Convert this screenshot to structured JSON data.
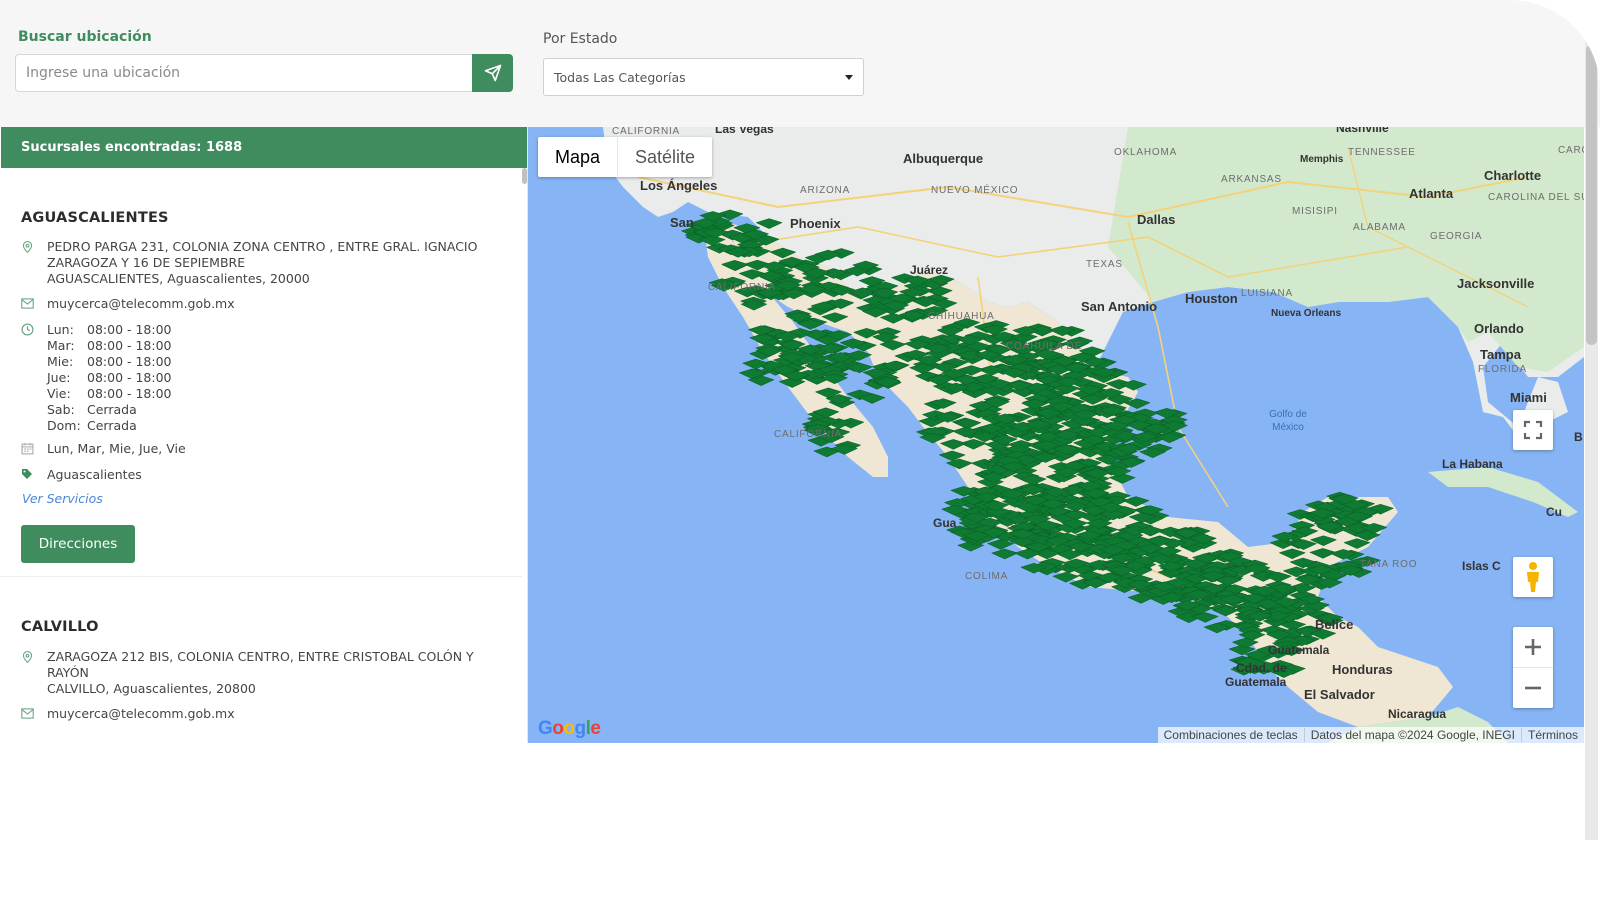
{
  "search": {
    "label": "Buscar ubicación",
    "placeholder": "Ingrese una ubicación",
    "value": ""
  },
  "state_filter": {
    "label": "Por Estado",
    "selected": "Todas Las Categorías"
  },
  "results": {
    "header": "Sucursales encontradas: 1688"
  },
  "branches": [
    {
      "name": "AGUASCALIENTES",
      "address_line1": "PEDRO PARGA 231, COLONIA ZONA CENTRO , ENTRE GRAL. IGNACIO",
      "address_line2": "ZARAGOZA Y 16 DE SEPIEMBRE",
      "address_line3": "AGUASCALIENTES, Aguascalientes, 20000",
      "email": "muycerca@telecomm.gob.mx",
      "hours": [
        {
          "day": "Lun:",
          "time": "08:00 - 18:00"
        },
        {
          "day": "Mar:",
          "time": "08:00 - 18:00"
        },
        {
          "day": "Mie:",
          "time": "08:00 - 18:00"
        },
        {
          "day": "Jue:",
          "time": "08:00 - 18:00"
        },
        {
          "day": "Vie:",
          "time": "08:00 - 18:00"
        },
        {
          "day": "Sab:",
          "time": "Cerrada"
        },
        {
          "day": "Dom:",
          "time": "Cerrada"
        }
      ],
      "open_days": "Lun, Mar, Mie, Jue, Vie",
      "category": "Aguascalientes",
      "services_link": "Ver Servicios",
      "directions_label": "Direcciones"
    },
    {
      "name": "CALVILLO",
      "address_line1": "ZARAGOZA 212 BIS, COLONIA CENTRO, ENTRE CRISTOBAL COLÓN Y",
      "address_line2": "RAYÓN",
      "address_line3": "CALVILLO, Aguascalientes, 20800",
      "email": "muycerca@telecomm.gob.mx"
    }
  ],
  "map": {
    "type_map": "Mapa",
    "type_satellite": "Satélite",
    "attribution_shortcuts": "Combinaciones de teclas",
    "attribution_data": "Datos del mapa ©2024 Google, INEGI",
    "attribution_terms": "Términos",
    "logo": "Google",
    "labels": {
      "las_vegas": "Las Vegas",
      "california": "CALIFORNIA",
      "nashville": "Nashville",
      "oklahoma": "OKLAHOMA",
      "tennessee": "TENNESSEE",
      "memphis": "Memphis",
      "carolina_del_norte": "CAROL",
      "albuquerque": "Albuquerque",
      "los_angeles": "Los Ángeles",
      "arizona": "ARIZONA",
      "nuevo_mexico": "NUEVO MÉXICO",
      "arkansas": "ARKANSAS",
      "charlotte": "Charlotte",
      "atlanta": "Atlanta",
      "carolina_del_sur": "CAROLINA DEL SUR",
      "san_diego": "San",
      "phoenix": "Phoenix",
      "misisipi": "MISISIPI",
      "alabama": "ALABAMA",
      "georgia": "GEORGIA",
      "dallas": "Dallas",
      "baja_california": "CALIFORNIA",
      "texas": "TEXAS",
      "juarez": "Juárez",
      "jacksonville": "Jacksonville",
      "luisiana": "LUISIANA",
      "houston": "Houston",
      "san_antonio": "San Antonio",
      "nueva_orleans": "Nueva Orleans",
      "chihuahua": "CHIHUAHUA",
      "orlando": "Orlando",
      "tampa": "Tampa",
      "florida": "FLORIDA",
      "coahuila": "COAHUILA DE",
      "miami": "Miami",
      "golfo": "Golfo de México",
      "baja_california_sur": "CALIFORNIA",
      "la_habana": "La Habana",
      "cuba": "Cu",
      "guadalajara": "Gua",
      "colima": "COLIMA",
      "quintana_roo": "TANA ROO",
      "islas": "Islas C",
      "belice": "Belice",
      "guatemala": "Guatemala",
      "cdad_guatemala_1": "Cdad. de",
      "cdad_guatemala_2": "Guatemala",
      "honduras": "Honduras",
      "el_salvador": "El Salvador",
      "nicaragua": "Nicaragua",
      "bahamas": "B"
    }
  },
  "colors": {
    "brand_green": "#3f8c5f",
    "marker_green": "#0e7a32",
    "water": "#86b4f4",
    "link_blue": "#4a86d6"
  }
}
